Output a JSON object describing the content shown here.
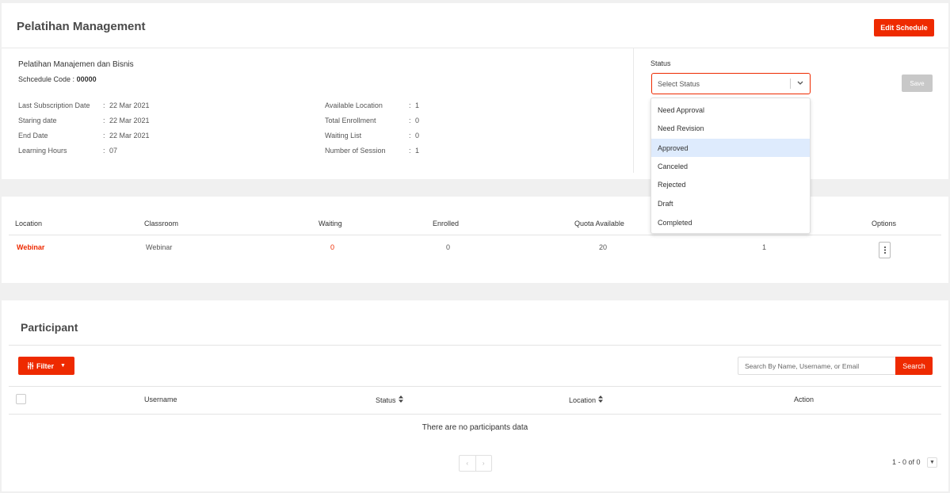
{
  "header": {
    "title": "Pelatihan Management",
    "edit_button": "Edit Schedule"
  },
  "course": {
    "name": "Pelatihan Manajemen dan Bisnis",
    "code_label": "Schcedule Code :",
    "code_value": "00000"
  },
  "info_left": [
    {
      "label": "Last Subscription Date",
      "value": "22 Mar 2021"
    },
    {
      "label": "Staring date",
      "value": "22 Mar 2021"
    },
    {
      "label": "End Date",
      "value": "22 Mar 2021"
    },
    {
      "label": "Learning Hours",
      "value": "07"
    }
  ],
  "info_right": [
    {
      "label": "Available Location",
      "value": "1"
    },
    {
      "label": "Total Enrollment",
      "value": "0"
    },
    {
      "label": "Waiting List",
      "value": "0"
    },
    {
      "label": "Number of Session",
      "value": "1"
    }
  ],
  "separator": ":",
  "status": {
    "label": "Status",
    "placeholder": "Select Status",
    "save_button": "Save",
    "options": [
      "Need Approval",
      "Need Revision",
      "Approved",
      "Canceled",
      "Rejected",
      "Draft",
      "Completed"
    ],
    "highlighted_option": "Approved"
  },
  "location_table": {
    "headers": [
      "Location",
      "Classroom",
      "Waiting",
      "Enrolled",
      "Quota Available",
      "Options"
    ],
    "rows": [
      {
        "location": "Webinar",
        "classroom": "Webinar",
        "waiting": "0",
        "enrolled": "0",
        "quota": "20",
        "extra": "1"
      }
    ]
  },
  "participant": {
    "title": "Participant",
    "filter_button": "Filter",
    "search_placeholder": "Search By Name, Username, or Email",
    "search_button": "Search",
    "headers": [
      "Username",
      "Status",
      "Location",
      "Action"
    ],
    "empty_message": "There are no participants data",
    "pagination_info": "1 - 0 of 0"
  },
  "colors": {
    "accent": "#ee2a00",
    "highlight": "#deebfd",
    "disabled": "#c8c8c8"
  }
}
